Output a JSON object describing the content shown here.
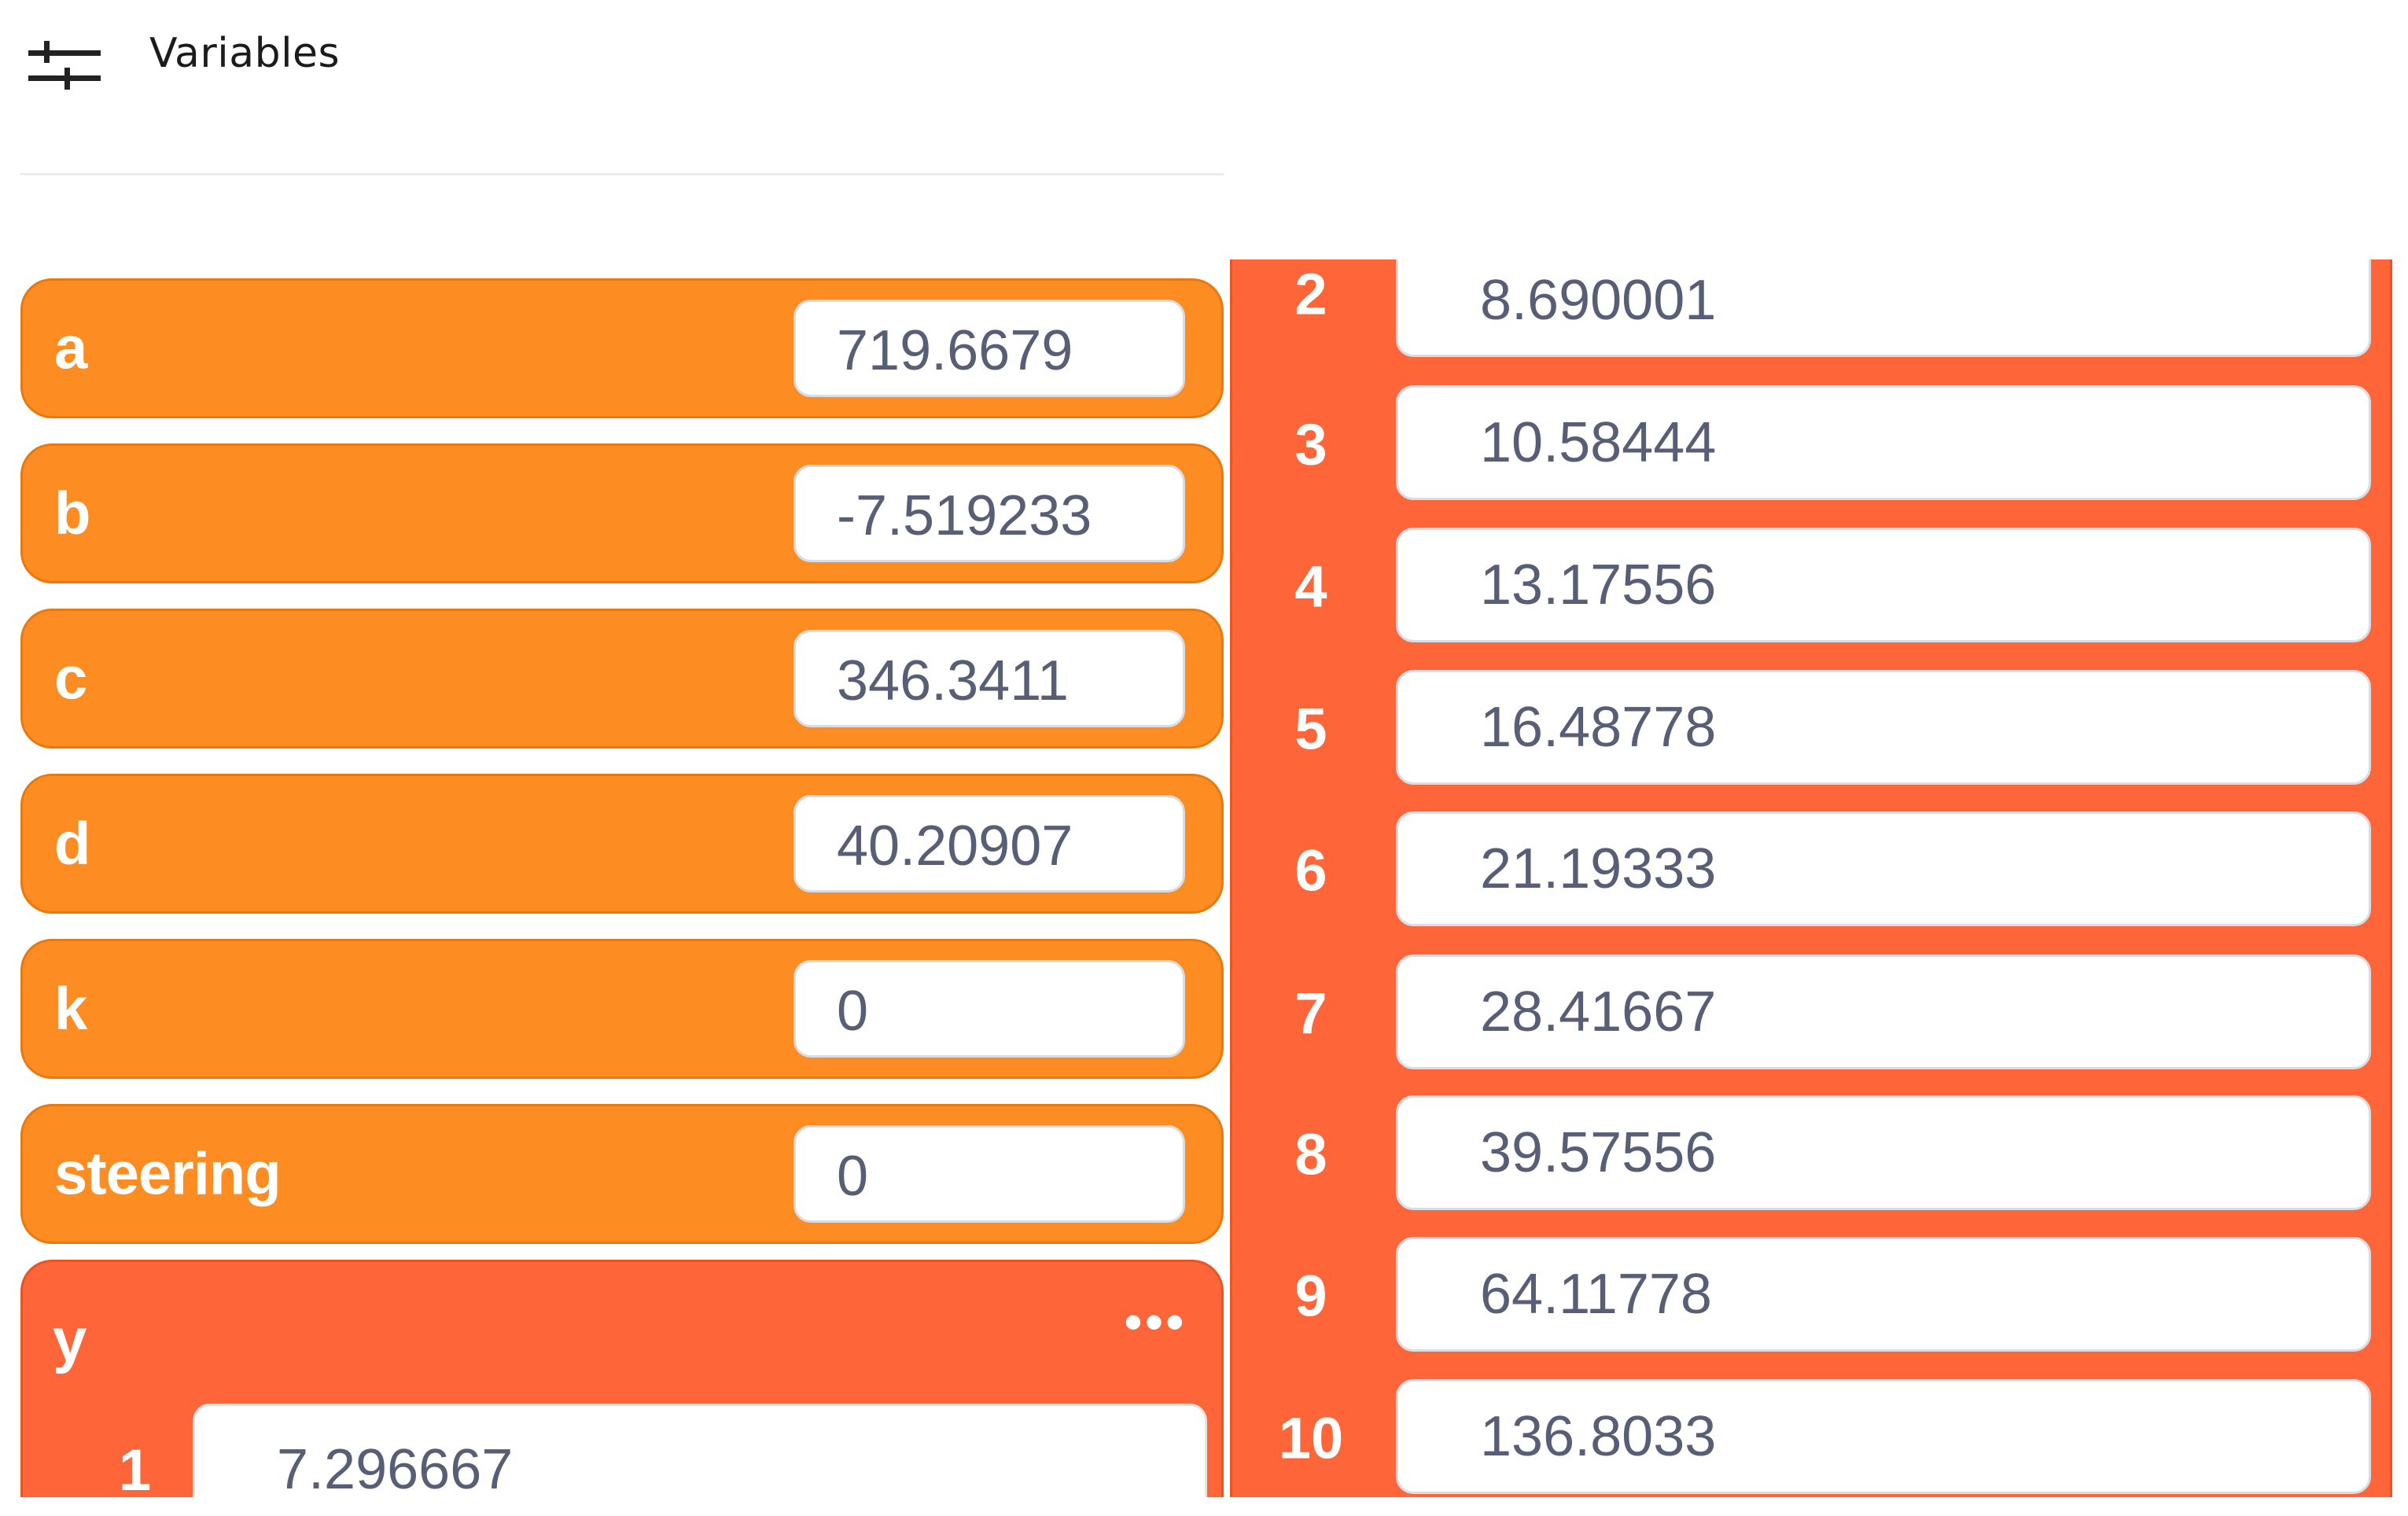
{
  "header": {
    "title": "Variables",
    "icon": "sliders-icon"
  },
  "variables": [
    {
      "name": "a",
      "value": "719.6679"
    },
    {
      "name": "b",
      "value": "-7.519233"
    },
    {
      "name": "c",
      "value": "346.3411"
    },
    {
      "name": "d",
      "value": "40.20907"
    },
    {
      "name": "k",
      "value": "0"
    },
    {
      "name": "steering",
      "value": "0"
    }
  ],
  "list_y": {
    "name": "y",
    "menu_label": "•••",
    "items": [
      {
        "index": "1",
        "value": "7.296667"
      },
      {
        "index": "2",
        "value": "8.690001"
      },
      {
        "index": "3",
        "value": "10.58444"
      },
      {
        "index": "4",
        "value": "13.17556"
      },
      {
        "index": "5",
        "value": "16.48778"
      },
      {
        "index": "6",
        "value": "21.19333"
      },
      {
        "index": "7",
        "value": "28.41667"
      },
      {
        "index": "8",
        "value": "39.57556"
      },
      {
        "index": "9",
        "value": "64.11778"
      },
      {
        "index": "10",
        "value": "136.8033"
      }
    ]
  },
  "colors": {
    "variable_orange": "#fd8d22",
    "list_red": "#fe6538",
    "value_text": "#575e75"
  }
}
